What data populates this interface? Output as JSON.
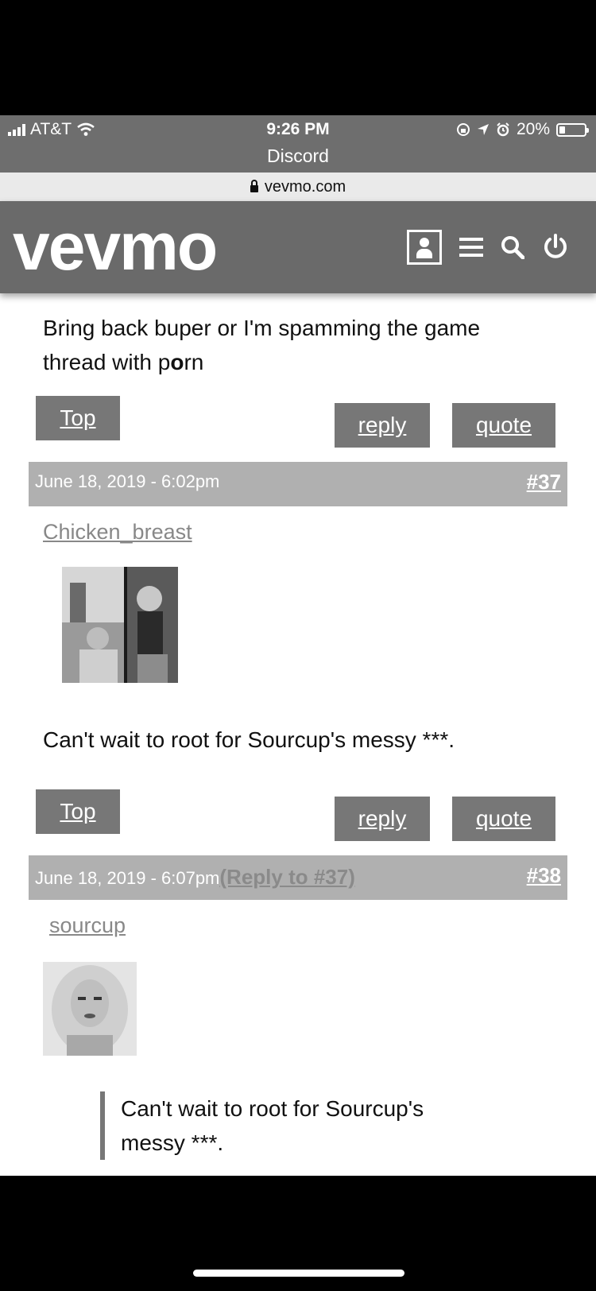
{
  "status_bar": {
    "carrier": "AT&T",
    "time": "9:26 PM",
    "back_app": "Discord",
    "battery": "20%"
  },
  "url_bar": {
    "domain": "vevmo.com"
  },
  "site_header": {
    "logo": "vevmo"
  },
  "posts": [
    {
      "body_prefix": "Bring back buper or I'm spamming the game thread with p",
      "body_bold": "o",
      "body_suffix": "rn",
      "top_label": "Top",
      "reply_label": "reply",
      "quote_label": "quote"
    },
    {
      "date": "June 18, 2019 - 6:02pm",
      "number": "#37",
      "username": "Chicken_breast",
      "body": "Can't wait to root for Sourcup's messy ***.",
      "top_label": "Top",
      "reply_label": "reply",
      "quote_label": "quote"
    },
    {
      "date": "June 18, 2019 - 6:07pm",
      "reply_to": "(Reply to #37)",
      "number": "#38",
      "username": "sourcup",
      "quote_text": "Can't wait to root for Sourcup's messy ***."
    }
  ]
}
